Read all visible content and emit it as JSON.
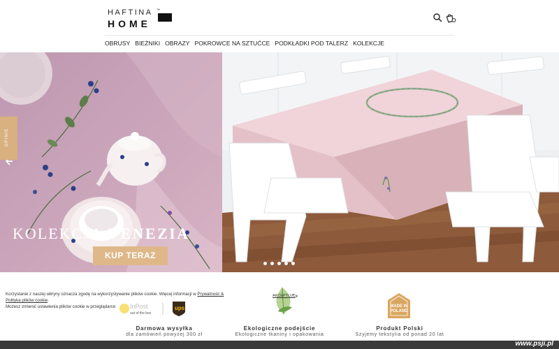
{
  "brand": {
    "line1": "HAFTINA",
    "line2": "HOME",
    "tm": "™"
  },
  "icons": {
    "search": "search-icon",
    "cart": "shopping-bag-icon"
  },
  "nav": {
    "items": [
      {
        "label": "OBRUSY"
      },
      {
        "label": "BIEŻNIKI"
      },
      {
        "label": "OBRAZY"
      },
      {
        "label": "POKROWCE NA SZTUĆCE"
      },
      {
        "label": "PODKŁADKI POD TALERZ"
      },
      {
        "label": "KOLEKCJE"
      }
    ]
  },
  "hero": {
    "title_light": "KOLEKCJA",
    "title_bold": "VENEZIA",
    "cta": "KUP TERAZ",
    "slide_count": 5
  },
  "side_tab": {
    "label": "OPINIE"
  },
  "benefits": [
    {
      "title": "Darmowa wysyłka",
      "subtitle": "dla zamówień powyżej 300 zł",
      "logo_text_1": "InPost",
      "logo_text_2": "out of the box",
      "logo_text_3": "ups"
    },
    {
      "title": "Ekologiczne podejście",
      "subtitle": "Ekologiczne tkaniny i opakowania"
    },
    {
      "title": "Produkt Polski",
      "subtitle": "Szyjemy tekstylia od ponad 20 lat",
      "badge_line1": "MADE IN",
      "badge_line2": "POLAND"
    }
  ],
  "cookie": {
    "text1": "Korzystanie z naszej witryny oznacza zgodę na wykorzystywanie plików cookie. Więcej informacji w ",
    "link": "Prywatność & Polityka plików cookie",
    "text2": ".",
    "text3": "Możesz zmienić ustawienia plików cookie w przeglądarce",
    "accept": "AKCEPTUJĘ",
    "close": "×"
  },
  "watermark": "www.psji.pl",
  "colors": {
    "accent": "#dfb88a",
    "hero_pink": "#c7a3ba",
    "bottom_bar": "#3a3a3a"
  }
}
